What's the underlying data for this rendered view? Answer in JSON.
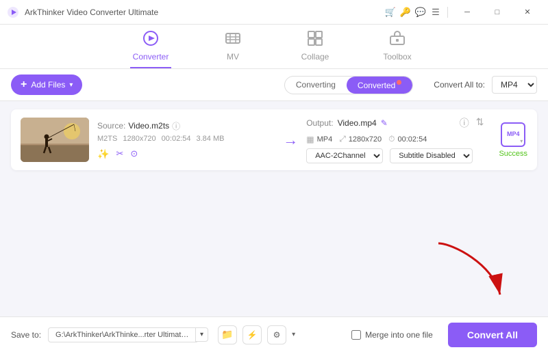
{
  "app": {
    "title": "ArkThinker Video Converter Ultimate"
  },
  "titlebar": {
    "controls": [
      "cart-icon",
      "key-icon",
      "chat-icon",
      "menu-icon",
      "minimize-icon",
      "maximize-icon",
      "close-icon"
    ]
  },
  "nav": {
    "tabs": [
      {
        "id": "converter",
        "label": "Converter",
        "active": true
      },
      {
        "id": "mv",
        "label": "MV",
        "active": false
      },
      {
        "id": "collage",
        "label": "Collage",
        "active": false
      },
      {
        "id": "toolbox",
        "label": "Toolbox",
        "active": false
      }
    ]
  },
  "toolbar": {
    "add_files_label": "Add Files",
    "converting_label": "Converting",
    "converted_label": "Converted",
    "convert_all_to_label": "Convert All to:",
    "convert_all_format": "MP4"
  },
  "file_card": {
    "source_label": "Source:",
    "source_value": "Video.m2ts",
    "meta_format": "M2TS",
    "meta_resolution": "1280x720",
    "meta_duration": "00:02:54",
    "meta_size": "3.84 MB",
    "output_label": "Output:",
    "output_value": "Video.mp4",
    "out_format": "MP4",
    "out_resolution": "1280x720",
    "out_duration": "00:02:54",
    "audio_channel": "AAC-2Channel",
    "subtitle": "Subtitle Disabled",
    "success_text": "Success",
    "success_format": "MP4"
  },
  "bottom": {
    "save_to_label": "Save to:",
    "save_path": "G:\\ArkThinker\\ArkThinke...rter Ultimate\\Converted",
    "merge_label": "Merge into one file",
    "convert_all_label": "Convert All"
  }
}
